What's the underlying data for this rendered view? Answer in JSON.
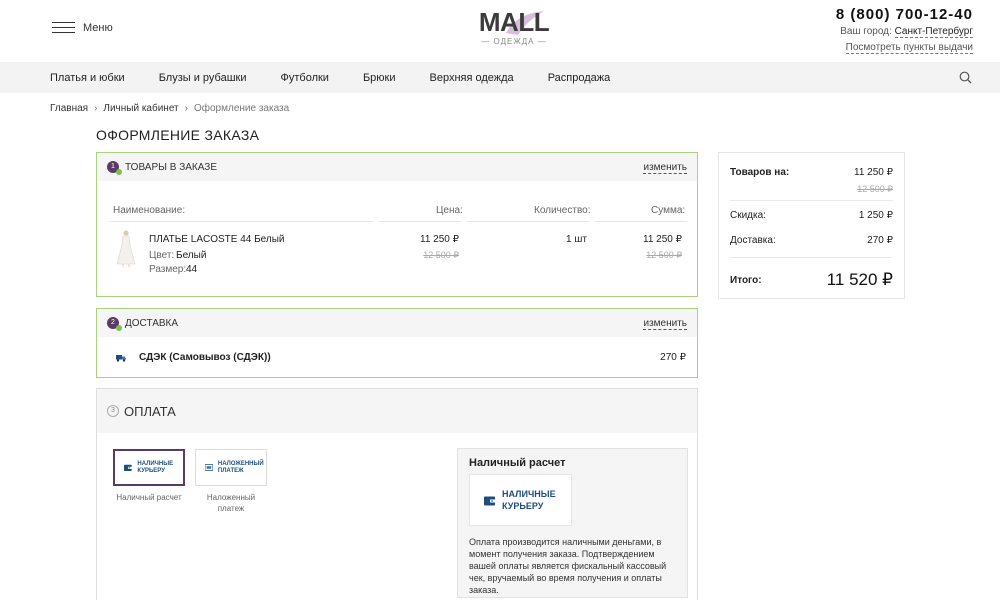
{
  "header": {
    "menu_label": "Меню",
    "logo_main": "MALL",
    "logo_sub": "— ОДЕЖДА —",
    "phone": "8 (800) 700-12-40",
    "city_prefix": "Ваш город:",
    "city": "Санкт-Петербург",
    "points_link": "Посмотреть пункты выдачи"
  },
  "nav": {
    "items": [
      "Платья и юбки",
      "Блузы и рубашки",
      "Футболки",
      "Брюки",
      "Верхняя одежда",
      "Распродажа"
    ]
  },
  "breadcrumbs": [
    "Главная",
    "Личный кабинет",
    "Оформление заказа"
  ],
  "page_title": "ОФОРМЛЕНИЕ ЗАКАЗА",
  "goods": {
    "step": "1",
    "title": "ТОВАРЫ В ЗАКАЗЕ",
    "change": "изменить",
    "columns": [
      "Наименование:",
      "Цена:",
      "Количество:",
      "Сумма:"
    ],
    "item": {
      "name": "ПЛАТЬЕ LACOSTE 44 Белый",
      "color_label": "Цвет:",
      "color": "Белый",
      "size_label": "Размер:",
      "size": "44",
      "price": "11 250 ₽",
      "price_old": "12 500 ₽",
      "qty": "1 шт",
      "sum": "11 250 ₽",
      "sum_old": "12 500 ₽"
    }
  },
  "delivery": {
    "step": "2",
    "title": "ДОСТАВКА",
    "change": "изменить",
    "method": "СДЭК (Самовывоз (СДЭК))",
    "price": "270 ₽"
  },
  "payment": {
    "step": "3",
    "title": "ОПЛАТА",
    "options": [
      {
        "icon_text": "НАЛИЧНЫЕ КУРЬЕРУ",
        "caption": "Наличный расчет",
        "selected": true
      },
      {
        "icon_text": "НАЛОЖЕННЫЙ ПЛАТЕЖ",
        "caption": "Наложенный платеж",
        "selected": false
      }
    ],
    "detail_title": "Наличный расчет",
    "detail_card_text": "НАЛИЧНЫЕ КУРЬЕРУ",
    "detail_desc": "Оплата производится наличными деньгами, в момент получения заказа. Подтверждением вашей оплаты является фискальный кассовый чек, вручаемый во время получения и оплаты заказа."
  },
  "summary": {
    "goods_label": "Товаров на:",
    "goods_value": "11 250 ₽",
    "goods_old": "12 500 ₽",
    "discount_label": "Скидка:",
    "discount_value": "1 250 ₽",
    "delivery_label": "Доставка:",
    "delivery_value": "270 ₽",
    "total_label": "Итого:",
    "total_value": "11 520 ₽"
  },
  "colors": {
    "accent": "#5b3a66",
    "success_border": "#a9d37a",
    "cash_blue": "#1d4f7c"
  }
}
